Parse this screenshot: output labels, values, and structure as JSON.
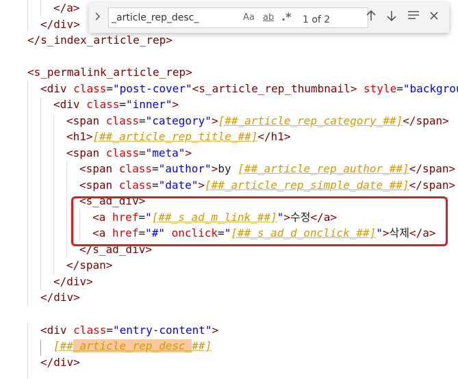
{
  "find_widget": {
    "query": "_article_rep_desc_",
    "case_option": "Aa",
    "word_option": "ab",
    "regex_option": ".*",
    "result_count": "1 of 2",
    "toggle_icon": "chevron-right-icon",
    "prev_icon": "arrow-up-icon",
    "next_icon": "arrow-down-icon",
    "selection_icon": "find-in-selection-icon",
    "close_icon": "close-icon"
  },
  "code": {
    "l1": {
      "p1": "</a>"
    },
    "l2": {
      "p1": "</div>"
    },
    "l3": {
      "p1": "</s_index_article_rep>"
    },
    "l5": {
      "p1": "<s_permalink_article_rep>"
    },
    "l6": {
      "p1": "<div ",
      "p2": "class",
      "p3": "=",
      "p4": "\"post-cover\"",
      "p5": "<s_article_rep_thumbnail> ",
      "p6": "style",
      "p7": "=",
      "p8": "\"backgrou"
    },
    "l7": {
      "p1": "<div ",
      "p2": "class",
      "p3": "=",
      "p4": "\"inner\"",
      "p5": ">"
    },
    "l8": {
      "p1": "<span ",
      "p2": "class",
      "p3": "=",
      "p4": "\"category\"",
      "p5": ">",
      "p6": "[##_article_rep_category_##]",
      "p7": "</span>"
    },
    "l9": {
      "p1": "<h1>",
      "p2": "[##_article_rep_title_##]",
      "p3": "</h1>"
    },
    "l10": {
      "p1": "<span ",
      "p2": "class",
      "p3": "=",
      "p4": "\"meta\"",
      "p5": ">"
    },
    "l11": {
      "p1": "<span ",
      "p2": "class",
      "p3": "=",
      "p4": "\"author\"",
      "p5": ">",
      "p6": "by ",
      "p7": "[##_article_rep_author_##]",
      "p8": "</span>"
    },
    "l12": {
      "p1": "<span ",
      "p2": "class",
      "p3": "=",
      "p4": "\"date\"",
      "p5": ">",
      "p6": "[##_article_rep_simple_date_##]",
      "p7": "</span>"
    },
    "l13": {
      "p1": "<s_ad_div>"
    },
    "l14": {
      "p1": "<a ",
      "p2": "href",
      "p3": "=",
      "p4": "\"",
      "p5": "[##_s_ad_m_link_##]",
      "p6": "\"",
      "p7": ">",
      "p8": "수정",
      "p9": "</a>"
    },
    "l15": {
      "p1": "<a ",
      "p2": "href",
      "p3": "=",
      "p4": "\"#\"",
      "p5": " onclick",
      "p6": "=",
      "p7": "\"",
      "p8": "[##_s_ad_d_onclick_##]",
      "p9": "\"",
      "p10": ">",
      "p11": "삭제",
      "p12": "</a>"
    },
    "l16": {
      "p1": "</s_ad_div>"
    },
    "l17": {
      "p1": "</span>"
    },
    "l18": {
      "p1": "</div>"
    },
    "l19": {
      "p1": "</div>"
    },
    "l21": {
      "p1": "<div ",
      "p2": "class",
      "p3": "=",
      "p4": "\"entry-content\"",
      "p5": ">"
    },
    "l22": {
      "p1": "[##",
      "p2": "_article_rep_desc_",
      "p3": "##]"
    },
    "l23": {
      "p1": "</div>"
    }
  },
  "colors": {
    "tag": "#800000",
    "attribute": "#e50000",
    "string": "#0000ff",
    "template_variable": "#d79b00",
    "find_match": "#f8c9a0",
    "highlight_box": "#e0191d"
  }
}
